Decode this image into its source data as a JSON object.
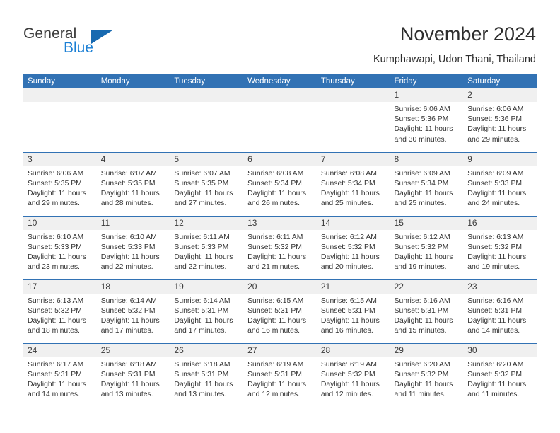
{
  "brand": {
    "name_part1": "General",
    "name_part2": "Blue",
    "logo_icon": "triangle-logo-icon",
    "color_dark": "#3d3d3d",
    "color_blue": "#1b7fd4"
  },
  "header": {
    "title": "November 2024",
    "subtitle": "Kumphawapi, Udon Thani, Thailand"
  },
  "theme": {
    "header_blue": "#3272b4",
    "daynum_gray": "#f0f0f0",
    "text": "#333333"
  },
  "weekdays": [
    "Sunday",
    "Monday",
    "Tuesday",
    "Wednesday",
    "Thursday",
    "Friday",
    "Saturday"
  ],
  "labels": {
    "sunrise_prefix": "Sunrise:",
    "sunset_prefix": "Sunset:",
    "daylight_prefix": "Daylight:"
  },
  "weeks": [
    [
      {
        "day": "",
        "empty": true
      },
      {
        "day": "",
        "empty": true
      },
      {
        "day": "",
        "empty": true
      },
      {
        "day": "",
        "empty": true
      },
      {
        "day": "",
        "empty": true
      },
      {
        "day": "1",
        "sunrise": "Sunrise: 6:06 AM",
        "sunset": "Sunset: 5:36 PM",
        "daylight": "Daylight: 11 hours and 30 minutes."
      },
      {
        "day": "2",
        "sunrise": "Sunrise: 6:06 AM",
        "sunset": "Sunset: 5:36 PM",
        "daylight": "Daylight: 11 hours and 29 minutes."
      }
    ],
    [
      {
        "day": "3",
        "sunrise": "Sunrise: 6:06 AM",
        "sunset": "Sunset: 5:35 PM",
        "daylight": "Daylight: 11 hours and 29 minutes."
      },
      {
        "day": "4",
        "sunrise": "Sunrise: 6:07 AM",
        "sunset": "Sunset: 5:35 PM",
        "daylight": "Daylight: 11 hours and 28 minutes."
      },
      {
        "day": "5",
        "sunrise": "Sunrise: 6:07 AM",
        "sunset": "Sunset: 5:35 PM",
        "daylight": "Daylight: 11 hours and 27 minutes."
      },
      {
        "day": "6",
        "sunrise": "Sunrise: 6:08 AM",
        "sunset": "Sunset: 5:34 PM",
        "daylight": "Daylight: 11 hours and 26 minutes."
      },
      {
        "day": "7",
        "sunrise": "Sunrise: 6:08 AM",
        "sunset": "Sunset: 5:34 PM",
        "daylight": "Daylight: 11 hours and 25 minutes."
      },
      {
        "day": "8",
        "sunrise": "Sunrise: 6:09 AM",
        "sunset": "Sunset: 5:34 PM",
        "daylight": "Daylight: 11 hours and 25 minutes."
      },
      {
        "day": "9",
        "sunrise": "Sunrise: 6:09 AM",
        "sunset": "Sunset: 5:33 PM",
        "daylight": "Daylight: 11 hours and 24 minutes."
      }
    ],
    [
      {
        "day": "10",
        "sunrise": "Sunrise: 6:10 AM",
        "sunset": "Sunset: 5:33 PM",
        "daylight": "Daylight: 11 hours and 23 minutes."
      },
      {
        "day": "11",
        "sunrise": "Sunrise: 6:10 AM",
        "sunset": "Sunset: 5:33 PM",
        "daylight": "Daylight: 11 hours and 22 minutes."
      },
      {
        "day": "12",
        "sunrise": "Sunrise: 6:11 AM",
        "sunset": "Sunset: 5:33 PM",
        "daylight": "Daylight: 11 hours and 22 minutes."
      },
      {
        "day": "13",
        "sunrise": "Sunrise: 6:11 AM",
        "sunset": "Sunset: 5:32 PM",
        "daylight": "Daylight: 11 hours and 21 minutes."
      },
      {
        "day": "14",
        "sunrise": "Sunrise: 6:12 AM",
        "sunset": "Sunset: 5:32 PM",
        "daylight": "Daylight: 11 hours and 20 minutes."
      },
      {
        "day": "15",
        "sunrise": "Sunrise: 6:12 AM",
        "sunset": "Sunset: 5:32 PM",
        "daylight": "Daylight: 11 hours and 19 minutes."
      },
      {
        "day": "16",
        "sunrise": "Sunrise: 6:13 AM",
        "sunset": "Sunset: 5:32 PM",
        "daylight": "Daylight: 11 hours and 19 minutes."
      }
    ],
    [
      {
        "day": "17",
        "sunrise": "Sunrise: 6:13 AM",
        "sunset": "Sunset: 5:32 PM",
        "daylight": "Daylight: 11 hours and 18 minutes."
      },
      {
        "day": "18",
        "sunrise": "Sunrise: 6:14 AM",
        "sunset": "Sunset: 5:32 PM",
        "daylight": "Daylight: 11 hours and 17 minutes."
      },
      {
        "day": "19",
        "sunrise": "Sunrise: 6:14 AM",
        "sunset": "Sunset: 5:31 PM",
        "daylight": "Daylight: 11 hours and 17 minutes."
      },
      {
        "day": "20",
        "sunrise": "Sunrise: 6:15 AM",
        "sunset": "Sunset: 5:31 PM",
        "daylight": "Daylight: 11 hours and 16 minutes."
      },
      {
        "day": "21",
        "sunrise": "Sunrise: 6:15 AM",
        "sunset": "Sunset: 5:31 PM",
        "daylight": "Daylight: 11 hours and 16 minutes."
      },
      {
        "day": "22",
        "sunrise": "Sunrise: 6:16 AM",
        "sunset": "Sunset: 5:31 PM",
        "daylight": "Daylight: 11 hours and 15 minutes."
      },
      {
        "day": "23",
        "sunrise": "Sunrise: 6:16 AM",
        "sunset": "Sunset: 5:31 PM",
        "daylight": "Daylight: 11 hours and 14 minutes."
      }
    ],
    [
      {
        "day": "24",
        "sunrise": "Sunrise: 6:17 AM",
        "sunset": "Sunset: 5:31 PM",
        "daylight": "Daylight: 11 hours and 14 minutes."
      },
      {
        "day": "25",
        "sunrise": "Sunrise: 6:18 AM",
        "sunset": "Sunset: 5:31 PM",
        "daylight": "Daylight: 11 hours and 13 minutes."
      },
      {
        "day": "26",
        "sunrise": "Sunrise: 6:18 AM",
        "sunset": "Sunset: 5:31 PM",
        "daylight": "Daylight: 11 hours and 13 minutes."
      },
      {
        "day": "27",
        "sunrise": "Sunrise: 6:19 AM",
        "sunset": "Sunset: 5:31 PM",
        "daylight": "Daylight: 11 hours and 12 minutes."
      },
      {
        "day": "28",
        "sunrise": "Sunrise: 6:19 AM",
        "sunset": "Sunset: 5:32 PM",
        "daylight": "Daylight: 11 hours and 12 minutes."
      },
      {
        "day": "29",
        "sunrise": "Sunrise: 6:20 AM",
        "sunset": "Sunset: 5:32 PM",
        "daylight": "Daylight: 11 hours and 11 minutes."
      },
      {
        "day": "30",
        "sunrise": "Sunrise: 6:20 AM",
        "sunset": "Sunset: 5:32 PM",
        "daylight": "Daylight: 11 hours and 11 minutes."
      }
    ]
  ]
}
